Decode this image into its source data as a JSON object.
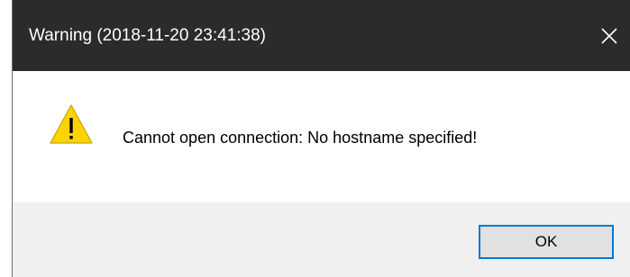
{
  "dialog": {
    "title": "Warning (2018-11-20 23:41:38)",
    "close_icon": "close-icon",
    "warning_icon": "warning-triangle-icon",
    "message": "Cannot open connection: No hostname specified!",
    "ok_label": "OK"
  },
  "colors": {
    "titlebar": "#2b2b2b",
    "title_text": "#ffffff",
    "footer": "#f0f0f0",
    "button_border": "#0078d7",
    "button_fill": "#e1e1e1",
    "warning_fill": "#ffd400"
  }
}
